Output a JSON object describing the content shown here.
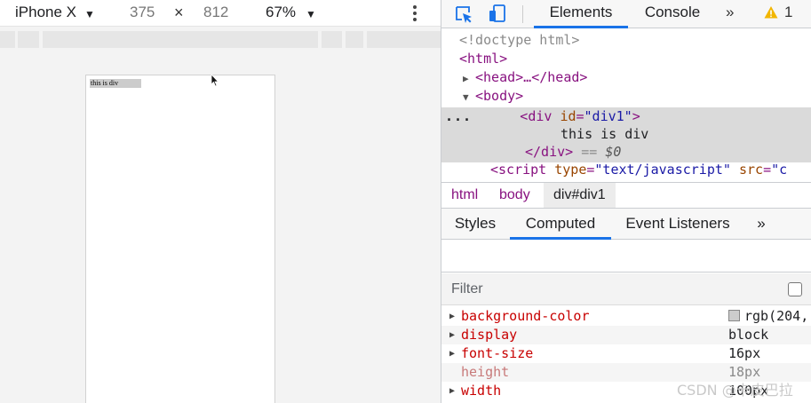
{
  "device_toolbar": {
    "device_name": "iPhone X",
    "caret": "▼",
    "width": "375",
    "times": "×",
    "height": "812",
    "zoom": "67%",
    "zoom_caret": "▼",
    "more_icon": "vertical-ellipsis-icon"
  },
  "viewport": {
    "div_text": "this is div",
    "div_background": "#cccccc"
  },
  "devtools": {
    "tabs": {
      "elements": "Elements",
      "console": "Console",
      "more": "»",
      "warning_count": "1"
    },
    "dom": {
      "doctype": "<!doctype html>",
      "html_open": "<html>",
      "head_collapsed": "<head>…</head>",
      "body_open": "<body>",
      "selected_dots": "...",
      "div_open_tag": "div",
      "div_attr_name": "id",
      "div_attr_value": "\"div1\"",
      "div_text": "this is div",
      "div_close": "</div>",
      "eq_marker": " == ",
      "dollar_zero": "$0",
      "script_tag": "script",
      "script_attr_type": "type",
      "script_attr_type_value": "\"text/javascript\"",
      "script_attr_src": "src",
      "script_attr_src_value": "\"c"
    },
    "breadcrumbs": [
      "html",
      "body",
      "div#div1"
    ],
    "subtabs": {
      "styles": "Styles",
      "computed": "Computed",
      "event_listeners": "Event Listeners",
      "more": "»"
    },
    "filter": {
      "label": "Filter"
    },
    "computed": [
      {
        "name": "background-color",
        "value": "rgb(204,",
        "swatch": "#cccccc",
        "expandable": true
      },
      {
        "name": "display",
        "value": "block",
        "expandable": true
      },
      {
        "name": "font-size",
        "value": "16px",
        "expandable": true
      },
      {
        "name": "height",
        "value": "18px",
        "expandable": false
      },
      {
        "name": "width",
        "value": "100px",
        "expandable": true
      }
    ]
  },
  "watermark": "CSDN @卡皮巴拉",
  "colors": {
    "accent": "#1a73e8",
    "tag": "#881280",
    "attr_name": "#994500",
    "attr_value": "#1a1aa6",
    "prop_name": "#c80000",
    "warning": "#f2b600"
  }
}
